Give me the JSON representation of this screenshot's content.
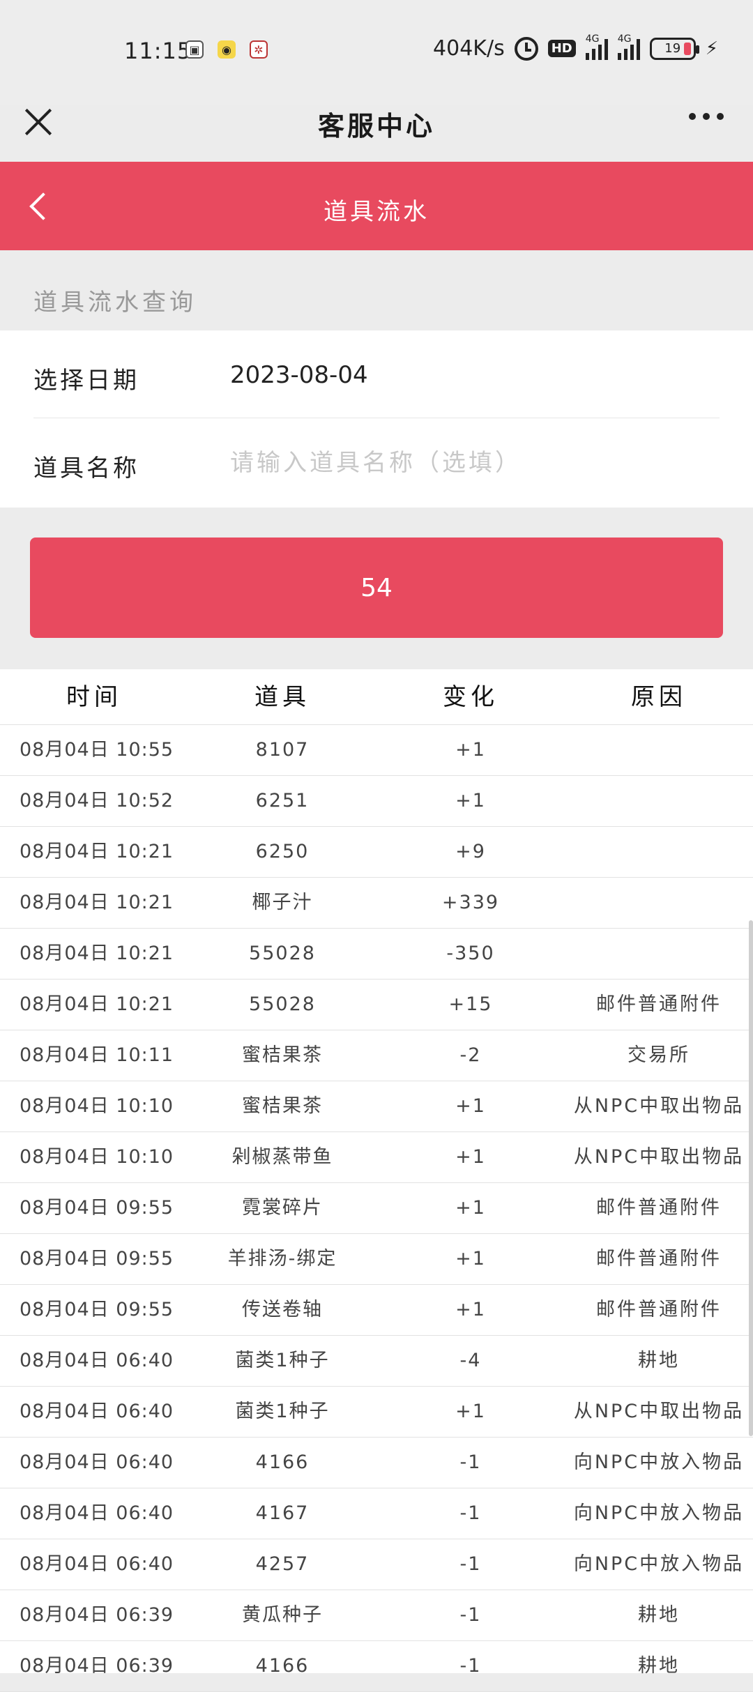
{
  "status_bar": {
    "time": "11:15",
    "net_speed": "404K/s",
    "hd": "HD",
    "signal1_tag": "4G",
    "signal2_tag": "4G",
    "battery": "19"
  },
  "title_bar": {
    "title": "客服中心"
  },
  "header": {
    "title": "道具流水"
  },
  "section": {
    "label": "道具流水查询"
  },
  "form": {
    "date_label": "选择日期",
    "date_value": "2023-08-04",
    "item_label": "道具名称",
    "item_placeholder": "请输入道具名称（选填）",
    "item_value": ""
  },
  "submit": {
    "label": "54"
  },
  "table": {
    "headers": [
      "时间",
      "道具",
      "变化",
      "原因"
    ],
    "rows": [
      {
        "time": "08月04日  10:55",
        "item": "8107",
        "change": "+1",
        "reason": ""
      },
      {
        "time": "08月04日  10:52",
        "item": "6251",
        "change": "+1",
        "reason": ""
      },
      {
        "time": "08月04日  10:21",
        "item": "6250",
        "change": "+9",
        "reason": ""
      },
      {
        "time": "08月04日  10:21",
        "item": "椰子汁",
        "change": "+339",
        "reason": ""
      },
      {
        "time": "08月04日  10:21",
        "item": "55028",
        "change": "-350",
        "reason": ""
      },
      {
        "time": "08月04日  10:21",
        "item": "55028",
        "change": "+15",
        "reason": "邮件普通附件"
      },
      {
        "time": "08月04日  10:11",
        "item": "蜜桔果茶",
        "change": "-2",
        "reason": "交易所"
      },
      {
        "time": "08月04日  10:10",
        "item": "蜜桔果茶",
        "change": "+1",
        "reason": "从NPC中取出物品"
      },
      {
        "time": "08月04日  10:10",
        "item": "剁椒蒸带鱼",
        "change": "+1",
        "reason": "从NPC中取出物品"
      },
      {
        "time": "08月04日  09:55",
        "item": "霓裳碎片",
        "change": "+1",
        "reason": "邮件普通附件"
      },
      {
        "time": "08月04日  09:55",
        "item": "羊排汤-绑定",
        "change": "+1",
        "reason": "邮件普通附件"
      },
      {
        "time": "08月04日  09:55",
        "item": "传送卷轴",
        "change": "+1",
        "reason": "邮件普通附件"
      },
      {
        "time": "08月04日  06:40",
        "item": "菌类1种子",
        "change": "-4",
        "reason": "耕地"
      },
      {
        "time": "08月04日  06:40",
        "item": "菌类1种子",
        "change": "+1",
        "reason": "从NPC中取出物品"
      },
      {
        "time": "08月04日  06:40",
        "item": "4166",
        "change": "-1",
        "reason": "向NPC中放入物品"
      },
      {
        "time": "08月04日  06:40",
        "item": "4167",
        "change": "-1",
        "reason": "向NPC中放入物品"
      },
      {
        "time": "08月04日  06:40",
        "item": "4257",
        "change": "-1",
        "reason": "向NPC中放入物品"
      },
      {
        "time": "08月04日  06:39",
        "item": "黄瓜种子",
        "change": "-1",
        "reason": "耕地"
      },
      {
        "time": "08月04日  06:39",
        "item": "4166",
        "change": "-1",
        "reason": "耕地"
      }
    ]
  },
  "colors": {
    "accent": "#e84a5f",
    "background": "#ececec"
  }
}
